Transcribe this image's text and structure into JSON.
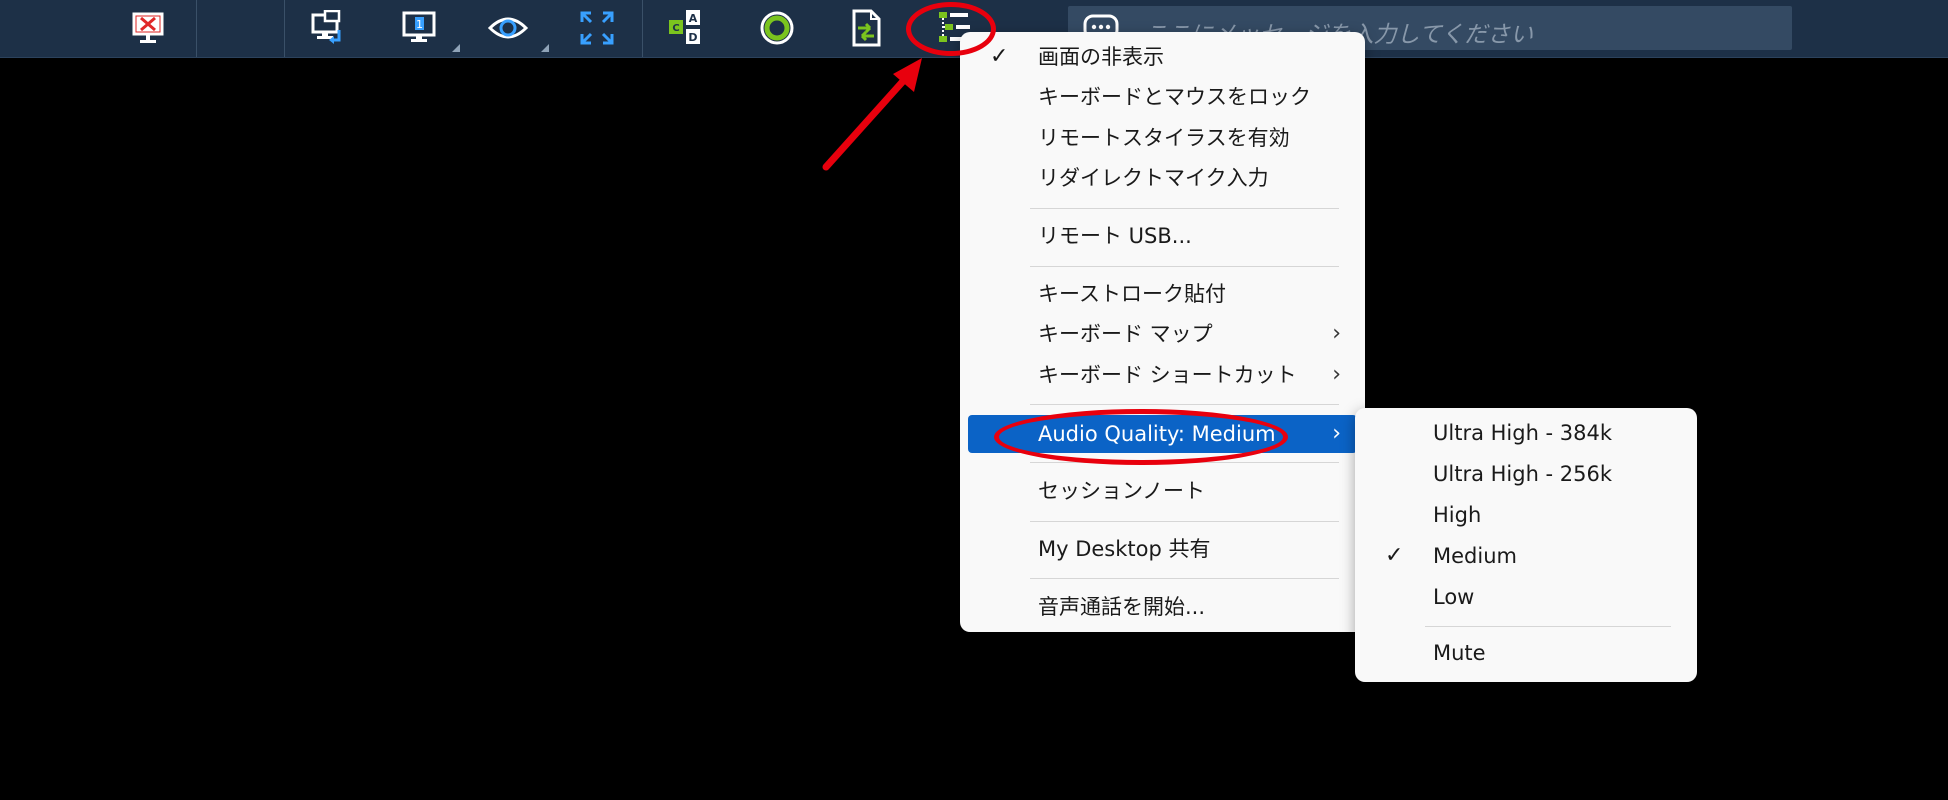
{
  "toolbar": {
    "icons": [
      "close-session-icon",
      "switch-monitor-icon",
      "monitor-select-icon",
      "view-only-icon",
      "fullscreen-icon",
      "keyboard-keys-icon",
      "record-icon",
      "file-transfer-icon",
      "tools-menu-icon"
    ],
    "chat_placeholder": "ここにメッセージを入力してください"
  },
  "main_menu": {
    "items": [
      {
        "label": "画面の非表示",
        "checked": true
      },
      {
        "label": "キーボードとマウスをロック"
      },
      {
        "label": "リモートスタイラスを有効"
      },
      {
        "label": "リダイレクトマイク入力"
      },
      {
        "label": "リモート USB..."
      },
      {
        "label": "キーストローク貼付"
      },
      {
        "label": "キーボード マップ",
        "submenu": true
      },
      {
        "label": "キーボード ショートカット",
        "submenu": true
      },
      {
        "label": "Audio Quality: Medium",
        "submenu": true,
        "highlighted": true
      },
      {
        "label": "セッションノート"
      },
      {
        "label": "My Desktop 共有"
      },
      {
        "label": "音声通話を開始..."
      }
    ]
  },
  "audio_submenu": {
    "items": [
      {
        "label": "Ultra High - 384k"
      },
      {
        "label": "Ultra High - 256k"
      },
      {
        "label": "High"
      },
      {
        "label": "Medium",
        "checked": true
      },
      {
        "label": "Low"
      },
      {
        "label": "Mute"
      }
    ]
  },
  "colors": {
    "toolbar_bg": "#1d3047",
    "highlight": "#0b63c6",
    "annotation_red": "#e8000d",
    "menu_bg": "#f9f9f9"
  }
}
